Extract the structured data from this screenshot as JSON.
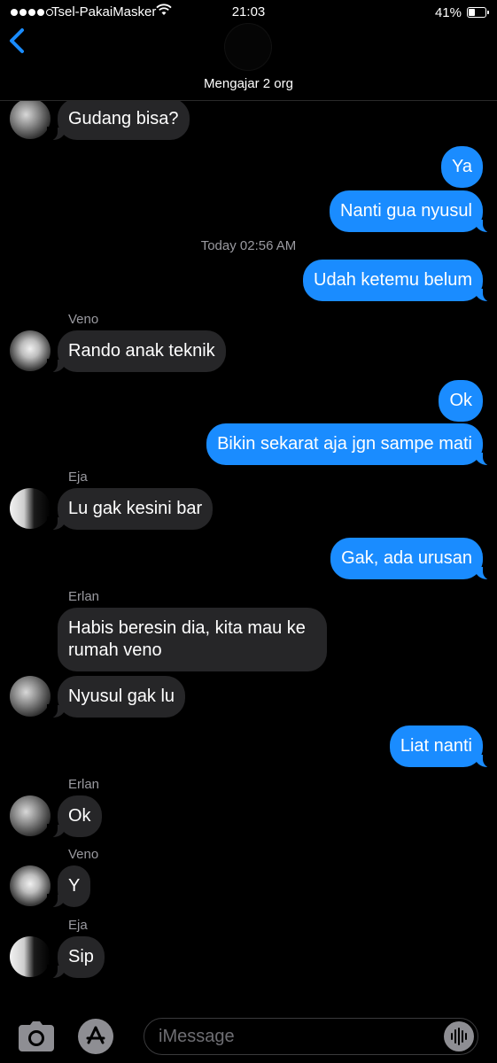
{
  "status_bar": {
    "carrier": "Tsel-PakaiMasker",
    "time": "21:03",
    "battery": "41%",
    "battery_level": 0.41
  },
  "header": {
    "group_name": "Mengajar 2 org"
  },
  "messages": [
    {
      "dir": "in",
      "avatar": "erlan",
      "text": "Gudang bisa?"
    },
    {
      "dir": "out",
      "text": "Ya"
    },
    {
      "dir": "out",
      "text": "Nanti gua nyusul"
    },
    {
      "timestamp": "Today 02:56 AM"
    },
    {
      "dir": "out",
      "text": "Udah ketemu belum"
    },
    {
      "sender": "Veno"
    },
    {
      "dir": "in",
      "avatar": "veno",
      "text": "Rando anak teknik"
    },
    {
      "dir": "out",
      "text": "Ok"
    },
    {
      "dir": "out",
      "text": "Bikin sekarat aja jgn sampe mati"
    },
    {
      "sender": "Eja"
    },
    {
      "dir": "in",
      "avatar": "eja",
      "text": "Lu gak kesini bar"
    },
    {
      "dir": "out",
      "text": "Gak, ada urusan"
    },
    {
      "sender": "Erlan"
    },
    {
      "dir": "in",
      "text": "Habis beresin dia, kita mau ke rumah veno"
    },
    {
      "dir": "in",
      "avatar": "erlan",
      "text": "Nyusul gak lu"
    },
    {
      "dir": "out",
      "text": "Liat nanti"
    },
    {
      "sender": "Erlan"
    },
    {
      "dir": "in",
      "avatar": "erlan",
      "text": "Ok"
    },
    {
      "sender": "Veno"
    },
    {
      "dir": "in",
      "avatar": "veno",
      "text": "Y"
    },
    {
      "sender": "Eja"
    },
    {
      "dir": "in",
      "avatar": "eja",
      "text": "Sip"
    }
  ],
  "input": {
    "placeholder": "iMessage"
  },
  "icons": {
    "back": "chevron-left-icon",
    "camera": "camera-icon",
    "app_store": "app-store-icon",
    "audio": "audio-waveform-icon",
    "wifi": "wifi-icon"
  },
  "colors": {
    "outgoing_bubble": "#1a8cff",
    "incoming_bubble": "#262628",
    "accent": "#1a8cff",
    "background": "#000000"
  }
}
